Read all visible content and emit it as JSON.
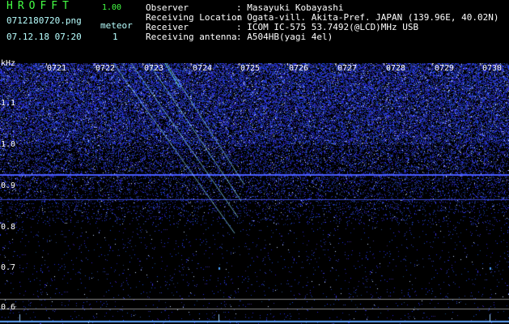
{
  "header": {
    "app_title": "HROFFT",
    "version": "1.00",
    "filename": "0712180720.png",
    "datetime": "07.12.18 07:20",
    "meteor_label": "meteor",
    "meteor_count": "1"
  },
  "info": [
    {
      "label": "Observer",
      "value": ": Masayuki Kobayashi"
    },
    {
      "label": "Receiving Location",
      "value": ": Ogata-vill. Akita-Pref. JAPAN (139.96E, 40.02N)"
    },
    {
      "label": "Receiver",
      "value": ": ICOM IC-575 53.7492(@LCD)MHz USB"
    },
    {
      "label": "Receiving antenna",
      "value": ": A504HB(yagi 4el)"
    }
  ],
  "axis": {
    "unit": "kHz",
    "y_labels": [
      "1.1",
      "1.0",
      "0.9",
      "0.8",
      "0.7",
      "0.6"
    ],
    "x_labels": [
      "0721",
      "0722",
      "0723",
      "0724",
      "0725",
      "0726",
      "0727",
      "0728",
      "0729",
      "0730"
    ]
  },
  "colors": {
    "background": "#000000",
    "noise": "#3040d0",
    "title": "#44ff44",
    "info_text": "#b8ffff"
  }
}
